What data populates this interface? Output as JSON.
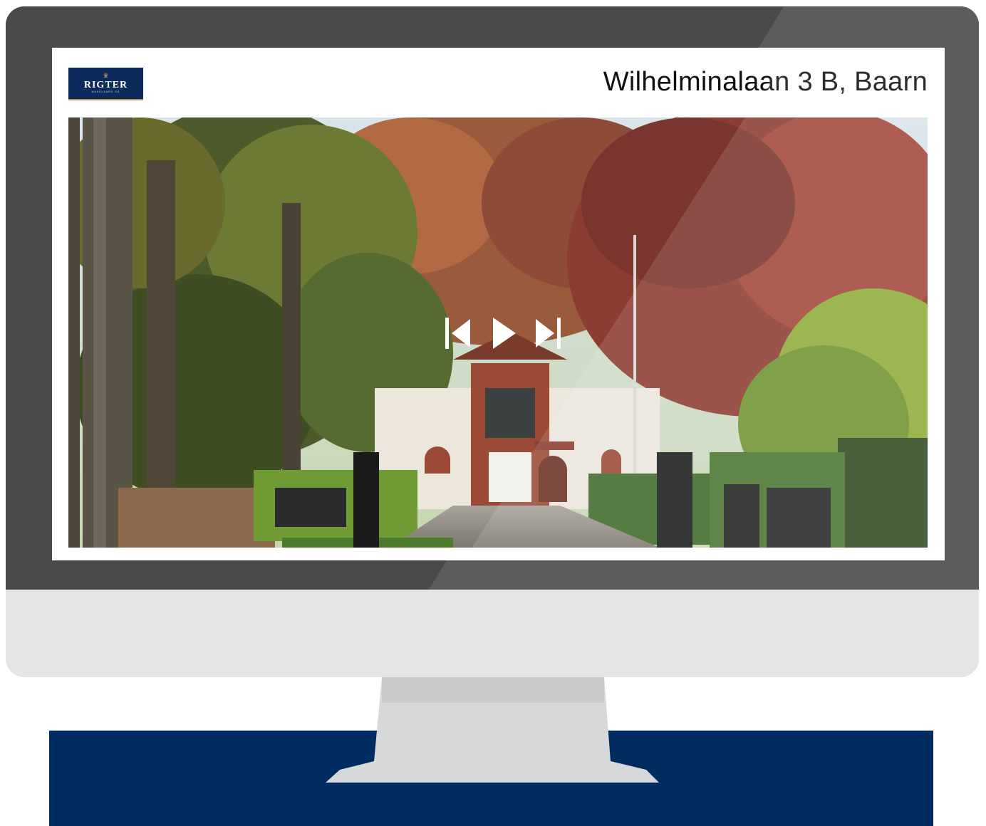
{
  "listing": {
    "address": "Wilhelminalaan 3 B, Baarn"
  },
  "brand": {
    "logo_name": "RIGTER",
    "logo_tagline": "MAKELAARS OG",
    "navy": "#002b61",
    "gold": "#c9a25a"
  },
  "media_player": {
    "icons": [
      "skip-previous-icon",
      "play-icon",
      "skip-next-icon"
    ]
  }
}
